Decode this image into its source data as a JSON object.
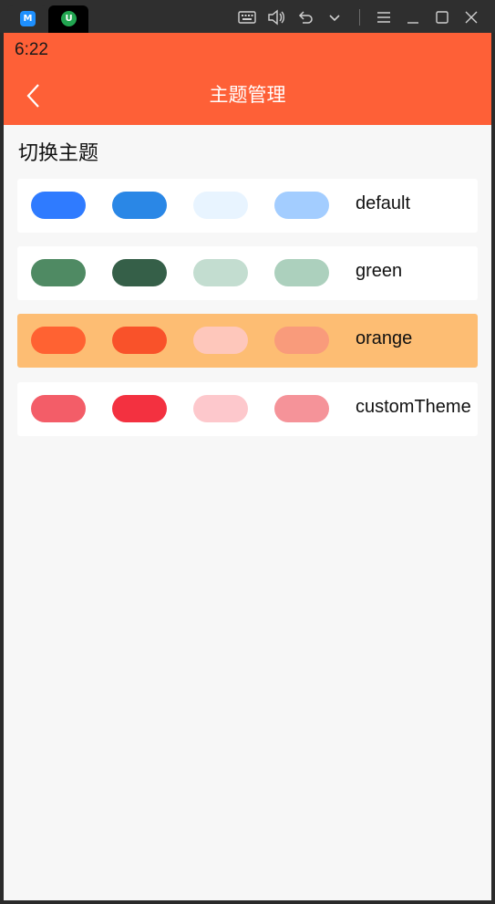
{
  "window": {
    "tabs": [
      {
        "icon": "app-m-icon",
        "glyph": "M",
        "color": "#1e90ff"
      },
      {
        "icon": "app-u-icon",
        "glyph": "U",
        "color": "#21a550"
      }
    ],
    "controls": [
      "keyboard-icon",
      "volume-icon",
      "undo-icon",
      "chevron-down-icon",
      "menu-icon",
      "minimize-icon",
      "maximize-icon",
      "close-icon"
    ]
  },
  "status": {
    "time": "6:22"
  },
  "header": {
    "title": "主题管理",
    "color": "#fe6037"
  },
  "section": {
    "title": "切换主题"
  },
  "themes": [
    {
      "name": "default",
      "colors": [
        "#2f7bff",
        "#2a87e6",
        "#e8f4ff",
        "#a3cdff"
      ],
      "selected": false
    },
    {
      "name": "green",
      "colors": [
        "#4f8a63",
        "#355f48",
        "#c3ddd0",
        "#acd0bd"
      ],
      "selected": false
    },
    {
      "name": "orange",
      "colors": [
        "#ff6232",
        "#f9522a",
        "#fec7bb",
        "#f99b7b"
      ],
      "selected": true
    },
    {
      "name": "customTheme",
      "colors": [
        "#f35d68",
        "#f33140",
        "#fdc8cc",
        "#f59399"
      ],
      "selected": false
    }
  ]
}
